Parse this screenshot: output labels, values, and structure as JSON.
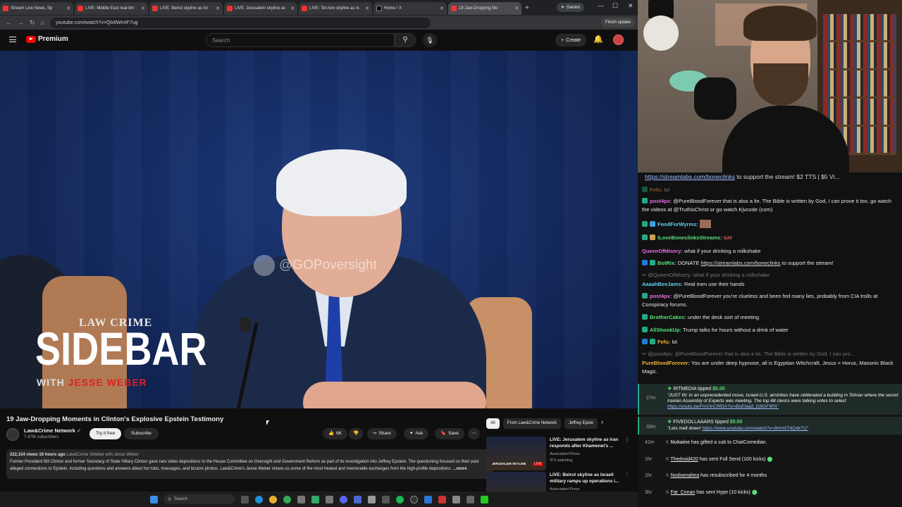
{
  "browser": {
    "tabs": [
      {
        "label": "Stream Live News, Sp"
      },
      {
        "label": "LIVE: Middle East real-tim"
      },
      {
        "label": "LIVE: Beirut skyline as Isr"
      },
      {
        "label": "LIVE: Jerusalem skyline as"
      },
      {
        "label": "LIVE: Tel Aviv skyline as Is"
      },
      {
        "label": "Home / X"
      },
      {
        "label": "19 Jaw-Dropping Mo"
      }
    ],
    "gemini_label": "Gemini",
    "url": "youtube.com/watch?v=Qlx8WmIF7ug",
    "finish_update": "Finish update"
  },
  "youtube": {
    "logo_text": "Premium",
    "search_placeholder": "Search",
    "create_label": "Create",
    "video_overlay": {
      "watermark": "@GOPoversight",
      "brand_top": "LAW CRIME",
      "brand_main": "SIDEBAR",
      "brand_with": "WITH",
      "brand_host": "JESSE WEBER"
    },
    "video_title": "19 Jaw-Dropping Moments in Clinton's Explosive Epstein Testimony",
    "channel_name": "Law&Crime Network",
    "subscribers": "7.47M subscribers",
    "try_free": "Try it free",
    "subscribe": "Subscribe",
    "likes": "6K",
    "share": "Share",
    "ask": "Ask",
    "save": "Save",
    "desc_meta": "222,154 views  16 hours ago",
    "desc_tag": "Law&Crime Sidebar with Jesse Weber",
    "desc_text": "Former President Bill Clinton and former Secretary of State Hillary Clinton gave rare video depositions to the House Committee on Oversight and Government Reform as part of its investigation into Jeffrey Epstein. The questioning focused on their past alleged connections to Epstein, including questions and answers about hot tubs, massages, and bizarre photos. Law&Crime's Jesse Weber shows us some of the most heated and memorable exchanges from the high-profile depositions.",
    "desc_more": "...more",
    "chips": [
      "All",
      "From Law&Crime Network",
      "Jeffrey Epste"
    ],
    "recs": [
      {
        "title": "LIVE: Jerusalem skyline as Iran responds after Khamenei's ...",
        "channel": "Associated Press",
        "stat": "472 watching",
        "badge": "LIVE"
      },
      {
        "title": "LIVE: Beirut skyline as Israeli military ramps up operations i...",
        "channel": "Associated Press",
        "stat": "",
        "badge": ""
      }
    ],
    "rec_overlay": "JERUSALEM SKYLINE"
  },
  "taskbar": {
    "search": "Search"
  },
  "chat": {
    "pinned_link": "https://streamlabs.com/boneclinks",
    "pinned_rest": " to support the stream! $2 TTS | $5 Vi...",
    "messages": [
      {
        "user": "Fefu:",
        "text": "lol",
        "color": "#f0b040",
        "dim": true
      },
      {
        "user": "post4px:",
        "text": "@PureBloodForever that is also a lie. The Bible is written by God, I can prove it too, go watch the videos at @TruthisChrist or go watch Kjvcode (com)",
        "color": "#e070e0",
        "dim": false
      },
      {
        "user": "FoodForWyrms:",
        "text": "",
        "color": "#5cd0f0",
        "dim": false
      },
      {
        "user": "ILoveBoneclinksStreams:",
        "text": "GAY",
        "color": "#59e07a",
        "dim": false
      },
      {
        "user": "QueenOfMisery:",
        "text": "what if your drinking a milkshake",
        "color": "#e070e0",
        "dim": false
      },
      {
        "user": "BotRix:",
        "text": "DONATE",
        "link": "https://streamlabs.com/boneclinks",
        "tail": "to support the stream!",
        "color": "#59e07a",
        "dim": false
      },
      {
        "user": "@QueenOfMisery:",
        "text": "what if your drinking a milkshake",
        "color": "#aaaaaa",
        "dim": true
      },
      {
        "user": "AaaahBeeJams:",
        "text": "Real men use their hands",
        "color": "#5cd0f0",
        "dim": false
      },
      {
        "user": "post4px:",
        "text": "@PureBloodForever you're clueless and been fed many lies, probably from CIA trolls at Conspiracy forums.",
        "color": "#e070e0",
        "dim": false
      },
      {
        "user": "BrotherCakes:",
        "text": "under the desk sort of meeting",
        "color": "#59e07a",
        "dim": false
      },
      {
        "user": "AllShookUp:",
        "text": "Trump talks for hours without a drink of water",
        "color": "#59e07a",
        "dim": false
      },
      {
        "user": "Fefu:",
        "text": "lol",
        "color": "#f0b040",
        "dim": false
      },
      {
        "user": "@post4px:",
        "text": "@PureBloodForever that is also a lie. The Bible is written by God, I can pro...",
        "color": "#aaaaaa",
        "dim": true
      },
      {
        "user": "PureBloodForever:",
        "text": "You are under deep hypnose, all is Egyptian Witchcraft, Jesus = Horus, Masonic Black Magic.",
        "color": "#f0b040",
        "dim": false
      }
    ]
  },
  "events": [
    {
      "time": "27m",
      "user": "IRTMEDIA",
      "action": "tipped",
      "amount": "$5.00",
      "msg": "\"JUST IN: In an unprecedented move, Israeli-U.S. airstrikes have obliterated a building in Tehran where the secret Iranian Assembly of Experts was meeting. The top 88 clerics were talking votes to select",
      "link": "https://youtu.be/FmOtrCRfDA?si=BoEtagd_Dj9GF9FA\""
    },
    {
      "time": "33m",
      "user": "FIVEDOLLAAARS",
      "action": "tipped",
      "amount": "$5.00",
      "msg": "\"Lets melt down!",
      "link": "https://www.youtube.com/watch?v=9mHST4Q4kTU\""
    },
    {
      "time": "42m",
      "user": "Nukaine",
      "action": "has gifted a sub to",
      "amount": "ChatComedian."
    },
    {
      "time": "1hr",
      "user": "Thedroid420",
      "action": "has sent",
      "amount": "Full Send (100 kicks)"
    },
    {
      "time": "1hr",
      "user": "Nodramahea",
      "action": "has resubscribed for 4 months",
      "amount": ""
    },
    {
      "time": "3hr",
      "user": "Fat_Conan",
      "action": "has sent",
      "amount": "Hype (10 kicks)"
    }
  ]
}
